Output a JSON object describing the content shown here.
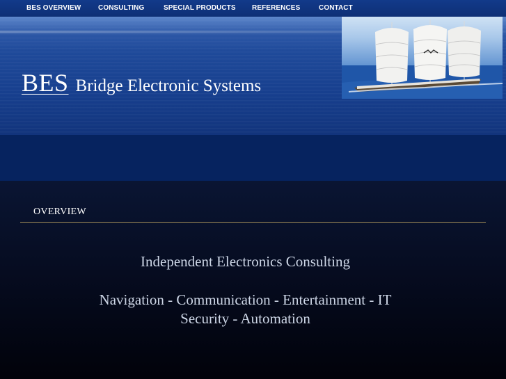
{
  "nav": {
    "items": [
      {
        "label": "BES OVERVIEW"
      },
      {
        "label": "CONSULTING"
      },
      {
        "label": "SPECIAL PRODUCTS"
      },
      {
        "label": "REFERENCES"
      },
      {
        "label": "CONTACT"
      }
    ]
  },
  "header": {
    "logo_abbr": "BES",
    "company_name": "Bridge Electronic Systems",
    "photo_icon": "sailing-yacht-image"
  },
  "overview": {
    "title": "OVERVIEW",
    "tagline": "Independent Electronics Consulting",
    "services_line1": "Navigation - Communication - Entertainment -  IT",
    "services_line2": "Security - Automation"
  },
  "colors": {
    "nav_bg": "#123a8a",
    "band": "#06235f",
    "rule": "#a8915a",
    "body_text": "#cdd6e6"
  }
}
